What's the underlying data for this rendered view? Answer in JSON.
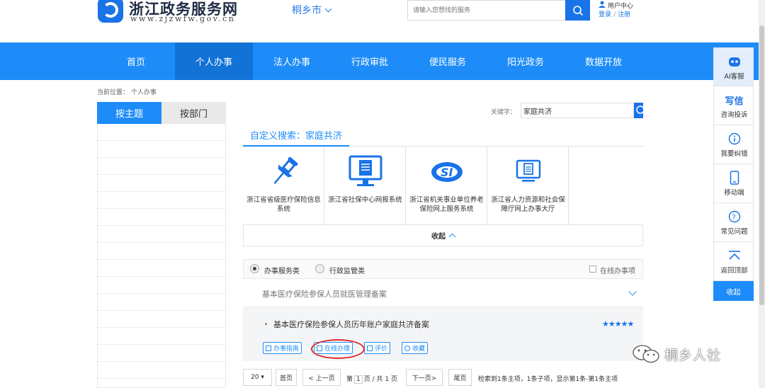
{
  "header": {
    "site_title": "浙江政务服务网",
    "site_url": "www.zjzwfw.gov.cn",
    "city": "桐乡市",
    "search_placeholder": "请输入您想找的服务",
    "user_center": "用户中心",
    "login": "登录",
    "separator": "/",
    "register": "注册"
  },
  "nav": {
    "items": [
      {
        "label": "首页"
      },
      {
        "label": "个人办事"
      },
      {
        "label": "法人办事"
      },
      {
        "label": "行政审批"
      },
      {
        "label": "便民服务"
      },
      {
        "label": "阳光政务"
      },
      {
        "label": "数据开放"
      }
    ],
    "active_index": 1
  },
  "breadcrumb": "当前位置： 个人办事",
  "left_tabs": {
    "by_topic": "按主题",
    "by_department": "按部门"
  },
  "keyword": {
    "label": "关键字：",
    "value": "家庭共济"
  },
  "custom_search": {
    "title": "自定义搜索：家庭共济",
    "cards": [
      {
        "label": "浙江省省级医疗保险信息系统",
        "icon": "pushpin-icon"
      },
      {
        "label": "浙江省社保中心网报系统",
        "icon": "monitor-document-icon"
      },
      {
        "label": "浙江省机关事业单位养老保险网上服务系统",
        "icon": "social-insurance-logo-icon"
      },
      {
        "label": "浙江省人力资源和社会保障厅网上办事大厅",
        "icon": "screen-document-icon"
      }
    ],
    "collapse_label": "收起"
  },
  "filter": {
    "option_service": "办事服务类",
    "option_supervision": "行政监管类",
    "online_only": "在线办事项"
  },
  "category": {
    "label": "基本医疗保险参保人员就医管理备案"
  },
  "item": {
    "title": "基本医疗保险参保人员历年账户家庭共济备案",
    "stars": "★★★★★",
    "actions": {
      "guide": "办事指南",
      "online": "在线办理",
      "rate": "评价",
      "favorite": "收藏"
    }
  },
  "pager": {
    "page_size": "20",
    "first": "首页",
    "prev": "< 上一页",
    "page_prefix": "第",
    "current_page": "1",
    "page_mid": "页 / 共 1 页",
    "next": "下一页>",
    "last": "尾页",
    "summary": "检索到1条主项，1条子项，显示第1条-第1条主项"
  },
  "right_bar": {
    "ai": "AI客服",
    "complaint_icon_text": "写信",
    "complaint": "咨询投诉",
    "report_error": "我要纠错",
    "mobile": "移动端",
    "faq": "常见问题",
    "back_top": "返回顶部",
    "collapse": "收起"
  },
  "watermark": "桐乡人社",
  "colors": {
    "primary": "#1d8cf8",
    "nav_active": "#1272d6",
    "highlight_ring": "#e02a2a"
  }
}
